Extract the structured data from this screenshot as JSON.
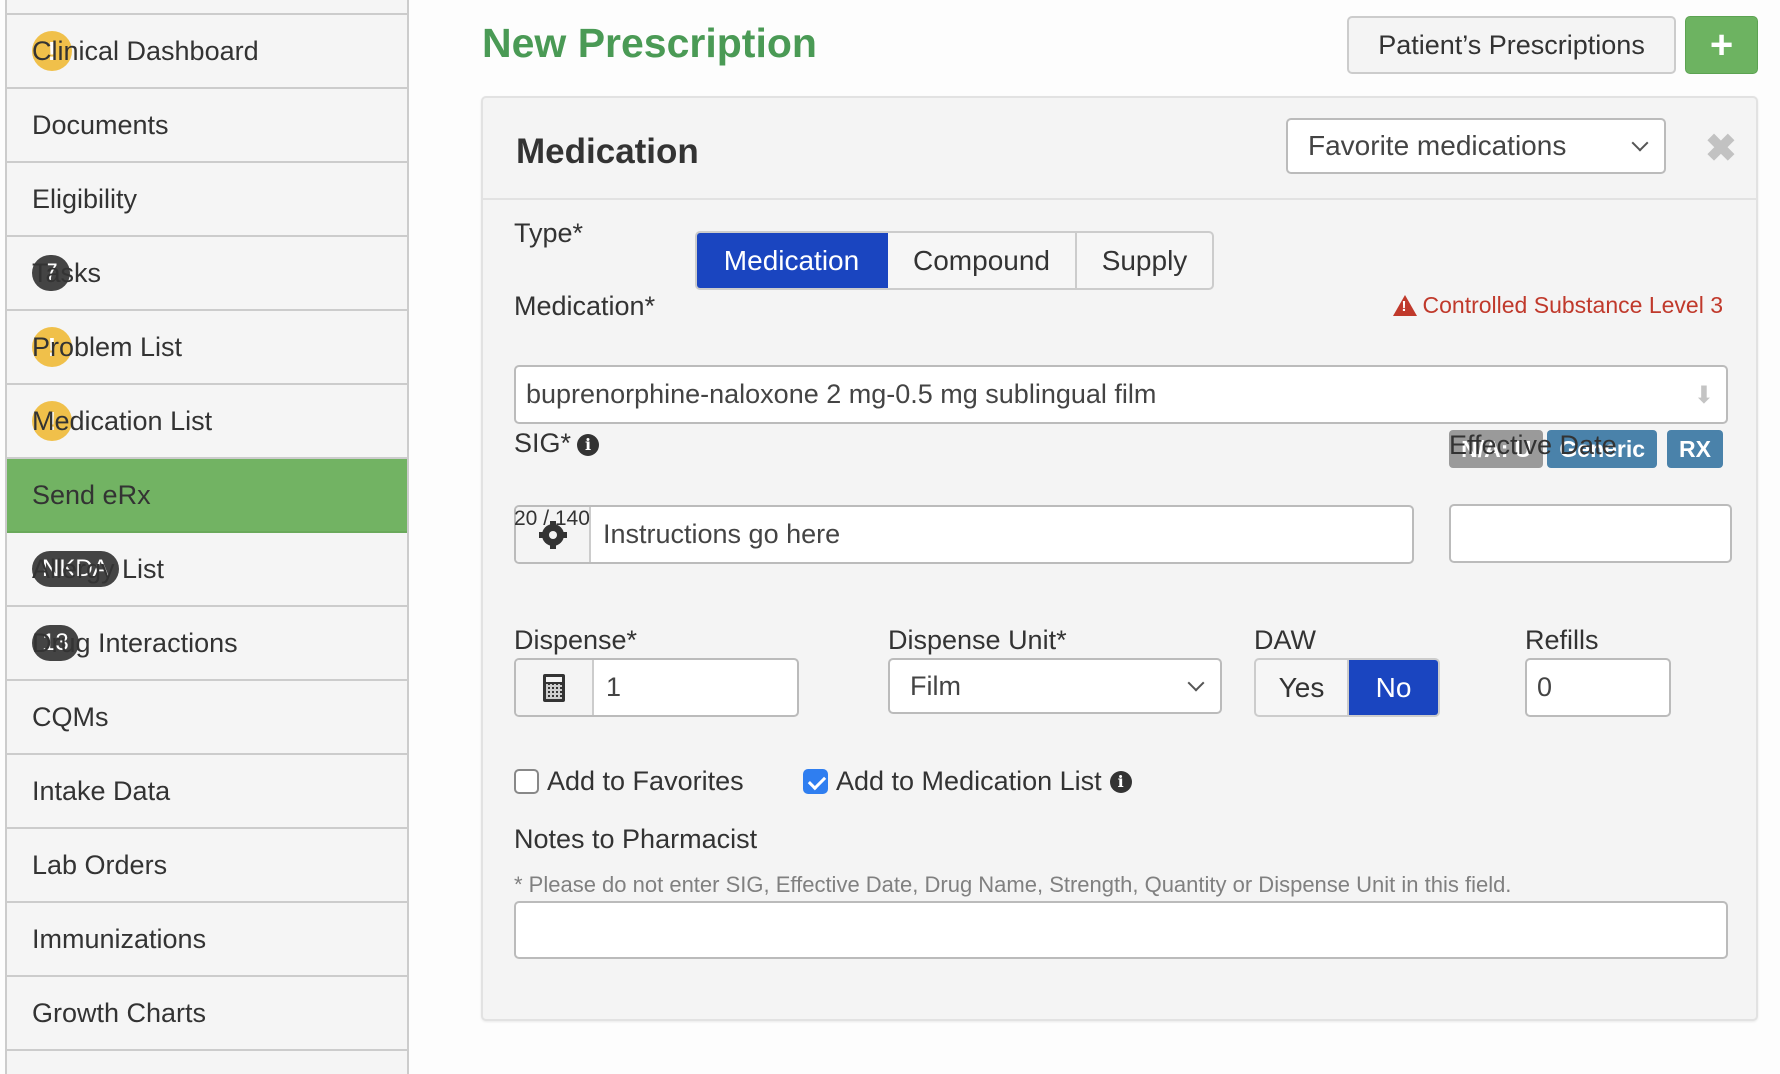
{
  "sidebar": {
    "items": [
      {
        "label": "Clinical Dashboard",
        "badge": "!",
        "badge_type": "warning"
      },
      {
        "label": "Documents"
      },
      {
        "label": "Eligibility"
      },
      {
        "label": "Tasks",
        "badge": "7",
        "badge_type": "count"
      },
      {
        "label": "Problem List",
        "badge": "!",
        "badge_type": "warning"
      },
      {
        "label": "Medication List",
        "badge": "!",
        "badge_type": "warning"
      },
      {
        "label": "Send eRx",
        "active": true
      },
      {
        "label": "Allergy List",
        "badge": "NKDA",
        "badge_type": "count"
      },
      {
        "label": "Drug Interactions",
        "badge": "13",
        "badge_type": "count"
      },
      {
        "label": "CQMs"
      },
      {
        "label": "Intake Data"
      },
      {
        "label": "Lab Orders"
      },
      {
        "label": "Immunizations"
      },
      {
        "label": "Growth Charts"
      }
    ]
  },
  "header": {
    "title": "New Prescription",
    "patients_prescriptions_label": "Patient’s Prescriptions",
    "add_icon": "plus-icon",
    "add_label": "+"
  },
  "panel": {
    "title": "Medication",
    "favorites_select": {
      "value": "Favorite medications"
    },
    "close_icon": "close-icon",
    "close_label": "✖",
    "type": {
      "label": "Type*",
      "options": [
        "Medication",
        "Compound",
        "Supply"
      ],
      "selected": "Medication"
    },
    "medication": {
      "label": "Medication*",
      "value": "buprenorphine-naloxone 2 mg-0.5 mg sublingual film",
      "warning": "Controlled Substance Level 3",
      "warning_color": "#c0392b",
      "tags": [
        {
          "text": "N/A: U",
          "color": "#9a9a9a"
        },
        {
          "text": "Generic",
          "color": "#4a82aa"
        },
        {
          "text": "RX",
          "color": "#4a82aa"
        }
      ]
    },
    "sig": {
      "label": "SIG*",
      "value": "Instructions go here",
      "counter": "20 / 140"
    },
    "effective_date": {
      "label": "Effective Date",
      "value": ""
    },
    "dispense": {
      "label": "Dispense*",
      "value": "1"
    },
    "dispense_unit": {
      "label": "Dispense Unit*",
      "value": "Film"
    },
    "daw": {
      "label": "DAW",
      "options": [
        "Yes",
        "No"
      ],
      "selected": "No"
    },
    "refills": {
      "label": "Refills",
      "value": "0"
    },
    "add_to_favorites": {
      "label": "Add to Favorites",
      "checked": false
    },
    "add_to_medication_list": {
      "label": "Add to Medication List",
      "checked": true
    },
    "notes": {
      "label": "Notes to Pharmacist",
      "help": "* Please do not enter SIG, Effective Date, Drug Name, Strength, Quantity or Dispense Unit in this field.",
      "value": ""
    }
  },
  "colors": {
    "accent_green": "#72b363",
    "title_green": "#4a9a55",
    "selected_blue": "#1a45c0",
    "warning_yellow": "#f0c04a"
  }
}
